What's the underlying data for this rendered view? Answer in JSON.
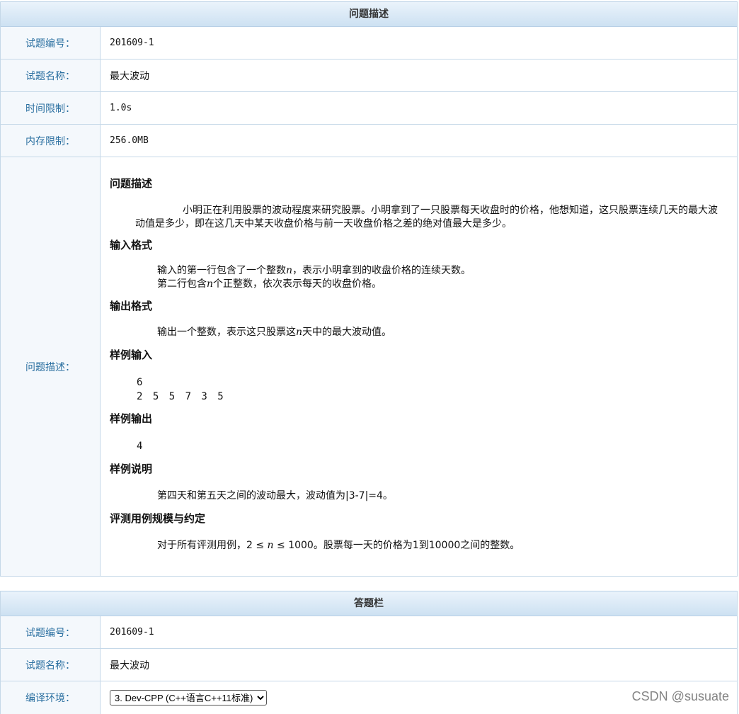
{
  "problem_panel": {
    "header": "问题描述",
    "rows": [
      {
        "label": "试题编号：",
        "value": "201609-1"
      },
      {
        "label": "试题名称：",
        "value": "最大波动"
      },
      {
        "label": "时间限制：",
        "value": "1.0s"
      },
      {
        "label": "内存限制：",
        "value": "256.0MB"
      }
    ],
    "desc_label": "问题描述：",
    "desc": {
      "h_problem": "问题描述",
      "problem_text": "小明正在利用股票的波动程度来研究股票。小明拿到了一只股票每天收盘时的价格，他想知道，这只股票连续几天的最大波动值是多少，即在这几天中某天收盘价格与前一天收盘价格之差的绝对值最大是多少。",
      "h_input": "输入格式",
      "input_line1_a": "输入的第一行包含了一个整数",
      "input_line1_var": "n",
      "input_line1_b": "，表示小明拿到的收盘价格的连续天数。",
      "input_line2_a": "第二行包含",
      "input_line2_var": "n",
      "input_line2_b": "个正整数，依次表示每天的收盘价格。",
      "h_output": "输出格式",
      "output_a": "输出一个整数，表示这只股票这",
      "output_var": "n",
      "output_b": "天中的最大波动值。",
      "h_sample_in": "样例输入",
      "sample_in_1": "6",
      "sample_in_2": "2 5 5 7 3 5",
      "h_sample_out": "样例输出",
      "sample_out": "4",
      "h_explain": "样例说明",
      "explain_text": "第四天和第五天之间的波动最大，波动值为|3-7|=4。",
      "h_constraints": "评测用例规模与约定",
      "constraints_a": "对于所有评测用例，2 ≤ ",
      "constraints_var": "n",
      "constraints_b": " ≤ 1000。股票每一天的价格为1到10000之间的整数。"
    }
  },
  "answer_panel": {
    "header": "答题栏",
    "rows": [
      {
        "label": "试题编号：",
        "value": "201609-1"
      },
      {
        "label": "试题名称：",
        "value": "最大波动"
      }
    ],
    "compiler_label": "编译环境：",
    "compiler_selected": "3. Dev-CPP (C++语言C++11标准)"
  },
  "watermark": "CSDN @susuate"
}
